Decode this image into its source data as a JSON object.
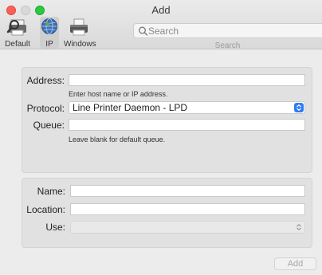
{
  "window": {
    "title": "Add"
  },
  "toolbar": {
    "default_label": "Default",
    "ip_label": "IP",
    "windows_label": "Windows"
  },
  "search": {
    "placeholder": "Search",
    "label": "Search"
  },
  "printer_panel": {
    "address_label": "Address:",
    "address_value": "",
    "address_hint": "Enter host name or IP address.",
    "protocol_label": "Protocol:",
    "protocol_value": "Line Printer Daemon - LPD",
    "queue_label": "Queue:",
    "queue_value": "",
    "queue_hint": "Leave blank for default queue."
  },
  "info_panel": {
    "name_label": "Name:",
    "name_value": "",
    "location_label": "Location:",
    "location_value": "",
    "use_label": "Use:",
    "use_value": ""
  },
  "footer": {
    "add_label": "Add"
  },
  "colors": {
    "accent": "#2f7df6",
    "close": "#fc5f57",
    "maximize": "#2bc840"
  },
  "icons": {
    "default": "printer-magnifier-icon",
    "ip": "globe-icon",
    "windows": "printer-icon",
    "search": "search-icon",
    "select": "chevron-updown-icon"
  }
}
